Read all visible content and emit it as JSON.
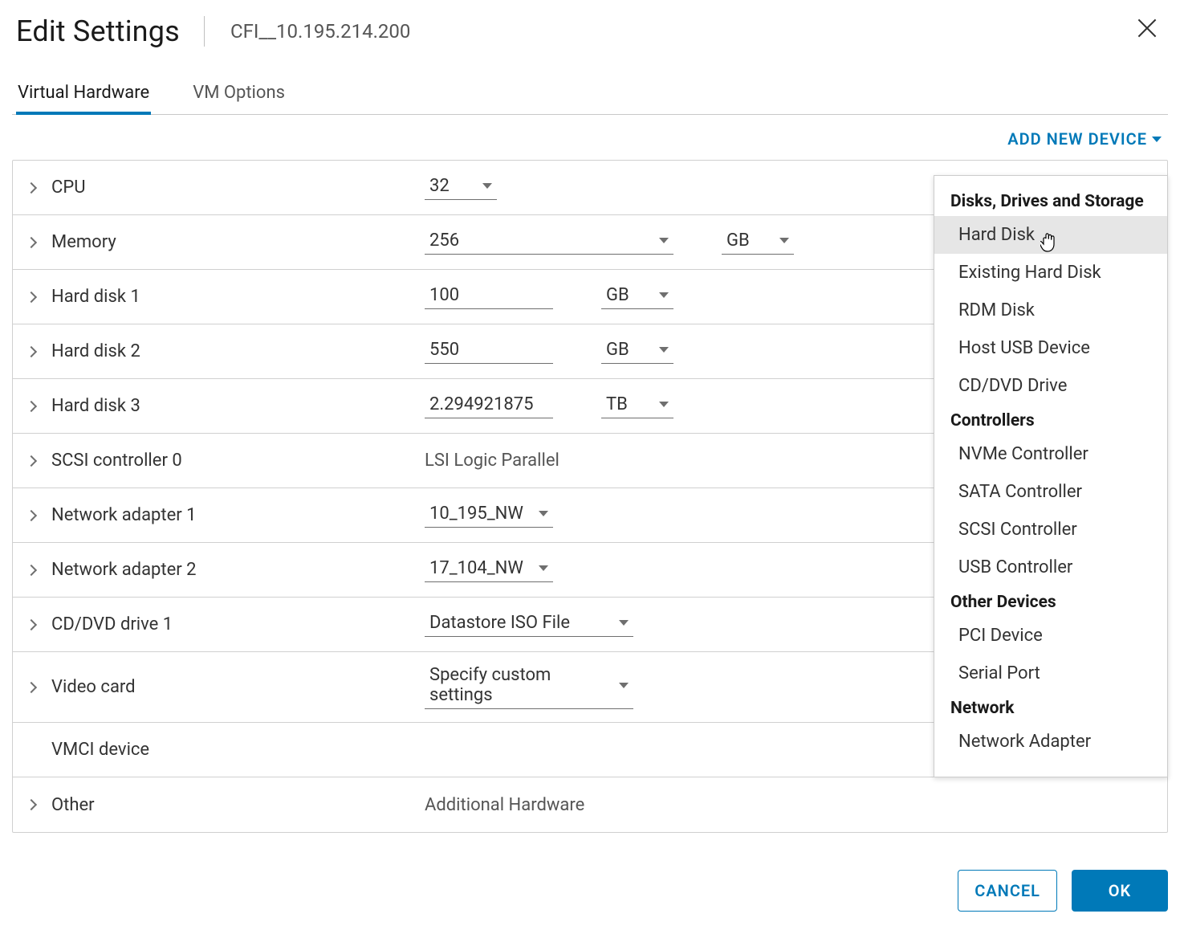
{
  "header": {
    "title": "Edit Settings",
    "subtitle": "CFI__10.195.214.200"
  },
  "tabs": {
    "virtual_hardware": "Virtual Hardware",
    "vm_options": "VM Options"
  },
  "add_device_label": "ADD NEW DEVICE",
  "rows": {
    "cpu": {
      "label": "CPU",
      "value": "32"
    },
    "memory": {
      "label": "Memory",
      "value": "256",
      "unit": "GB"
    },
    "hd1": {
      "label": "Hard disk 1",
      "value": "100",
      "unit": "GB"
    },
    "hd2": {
      "label": "Hard disk 2",
      "value": "550",
      "unit": "GB"
    },
    "hd3": {
      "label": "Hard disk 3",
      "value": "2.294921875",
      "unit": "TB"
    },
    "scsi0": {
      "label": "SCSI controller 0",
      "text": "LSI Logic Parallel"
    },
    "net1": {
      "label": "Network adapter 1",
      "value": "10_195_NW"
    },
    "net2": {
      "label": "Network adapter 2",
      "value": "17_104_NW"
    },
    "cddvd": {
      "label": "CD/DVD drive 1",
      "value": "Datastore ISO File"
    },
    "video": {
      "label": "Video card",
      "value": "Specify custom settings"
    },
    "vmci": {
      "label": "VMCI device"
    },
    "other": {
      "label": "Other",
      "text": "Additional Hardware"
    }
  },
  "dropdown": {
    "heading_storage": "Disks, Drives and Storage",
    "storage_items": {
      "hard_disk": "Hard Disk",
      "existing_hard_disk": "Existing Hard Disk",
      "rdm_disk": "RDM Disk",
      "host_usb": "Host USB Device",
      "cd_dvd": "CD/DVD Drive"
    },
    "heading_controllers": "Controllers",
    "controller_items": {
      "nvme": "NVMe Controller",
      "sata": "SATA Controller",
      "scsi": "SCSI Controller",
      "usb": "USB Controller"
    },
    "heading_other": "Other Devices",
    "other_items": {
      "pci": "PCI Device",
      "serial": "Serial Port"
    },
    "heading_network": "Network",
    "network_items": {
      "net_adapter": "Network Adapter"
    }
  },
  "footer": {
    "cancel": "CANCEL",
    "ok": "OK"
  }
}
